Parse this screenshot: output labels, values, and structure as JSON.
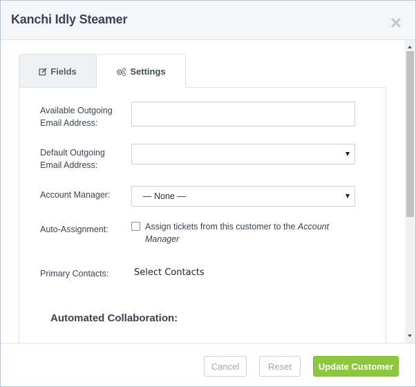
{
  "dialog": {
    "title": "Kanchi Idly Steamer"
  },
  "tabs": [
    {
      "label": "Fields",
      "icon": "edit-icon",
      "active": false
    },
    {
      "label": "Settings",
      "icon": "cogs-icon",
      "active": true
    }
  ],
  "settings": {
    "available_email": {
      "label_line1": "Available Outgoing",
      "label_line2": "Email Address:",
      "value": ""
    },
    "default_email": {
      "label_line1": "Default Outgoing",
      "label_line2": "Email Address:",
      "selected": ""
    },
    "account_manager": {
      "label": "Account Manager:",
      "selected": "— None —"
    },
    "auto_assignment": {
      "label": "Auto-Assignment:",
      "checked": false,
      "text_prefix": "Assign tickets from this customer to the ",
      "text_emphasis": "Account Manager"
    },
    "primary_contacts": {
      "label": "Primary Contacts:",
      "link": "Select Contacts"
    },
    "section_heading": "Automated Collaboration:"
  },
  "footer": {
    "cancel": "Cancel",
    "reset": "Reset",
    "update": "Update Customer"
  },
  "colors": {
    "accent_green": "#8dc63f",
    "header_bg": "#f4f6f9",
    "title_text": "#3a4451"
  }
}
